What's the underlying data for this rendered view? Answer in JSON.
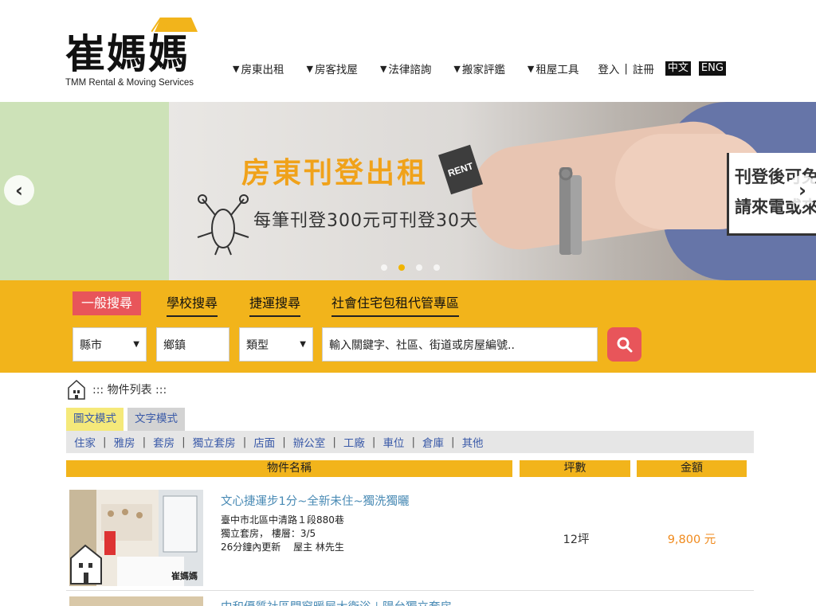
{
  "header": {
    "logo_title": "崔媽媽",
    "logo_subtitle": "TMM Rental & Moving Services",
    "nav": [
      {
        "label": "房東出租"
      },
      {
        "label": "房客找屋"
      },
      {
        "label": "法律諮詢"
      },
      {
        "label": "搬家評鑑"
      },
      {
        "label": "租屋工具"
      }
    ],
    "login": "登入",
    "register": "註冊",
    "lang_zh": "中文",
    "lang_en": "ENG"
  },
  "banner": {
    "title": "房東刊登出租",
    "tag": "RENT",
    "subtitle": "每筆刊登300元可刊登30天",
    "side_line1": "刊登後可免",
    "side_line2": "請來電或來",
    "active_slide": 1,
    "slide_count": 4,
    "colors": {
      "accent": "#f0a21a",
      "dot_active": "#f0b400"
    }
  },
  "search": {
    "tabs": [
      {
        "label": "一般搜尋",
        "active": true
      },
      {
        "label": "學校搜尋",
        "active": false
      },
      {
        "label": "捷運搜尋",
        "active": false
      },
      {
        "label": "社會住宅包租代管專區",
        "active": false
      }
    ],
    "county": "縣市",
    "township": "鄉鎮",
    "type": "類型",
    "keyword_placeholder": "輸入關鍵字、社區、街道或房屋編號..",
    "colors": {
      "band": "#f2b41b",
      "button": "#e8555a"
    }
  },
  "listing": {
    "breadcrumb": "::: 物件列表 :::",
    "mode_image": "圖文模式",
    "mode_text": "文字模式",
    "categories": [
      "住家",
      "雅房",
      "套房",
      "獨立套房",
      "店面",
      "辦公室",
      "工廠",
      "車位",
      "倉庫",
      "其他"
    ],
    "headers": {
      "name": "物件名稱",
      "area": "坪數",
      "price": "金額"
    },
    "items": [
      {
        "title": "文心捷運步1分~全新未住~獨洗獨曬",
        "address": "臺中市北區中清路１段880巷",
        "type_floor": "獨立套房，  樓層：3/5",
        "updated_owner": "26分鐘內更新　 屋主 林先生",
        "area": "12坪",
        "price": "9,800 元",
        "thumb_watermark": "崔媽媽"
      },
      {
        "title": "中和優質社區開窗暖屋大衛浴＋陽台獨立套房"
      }
    ]
  }
}
